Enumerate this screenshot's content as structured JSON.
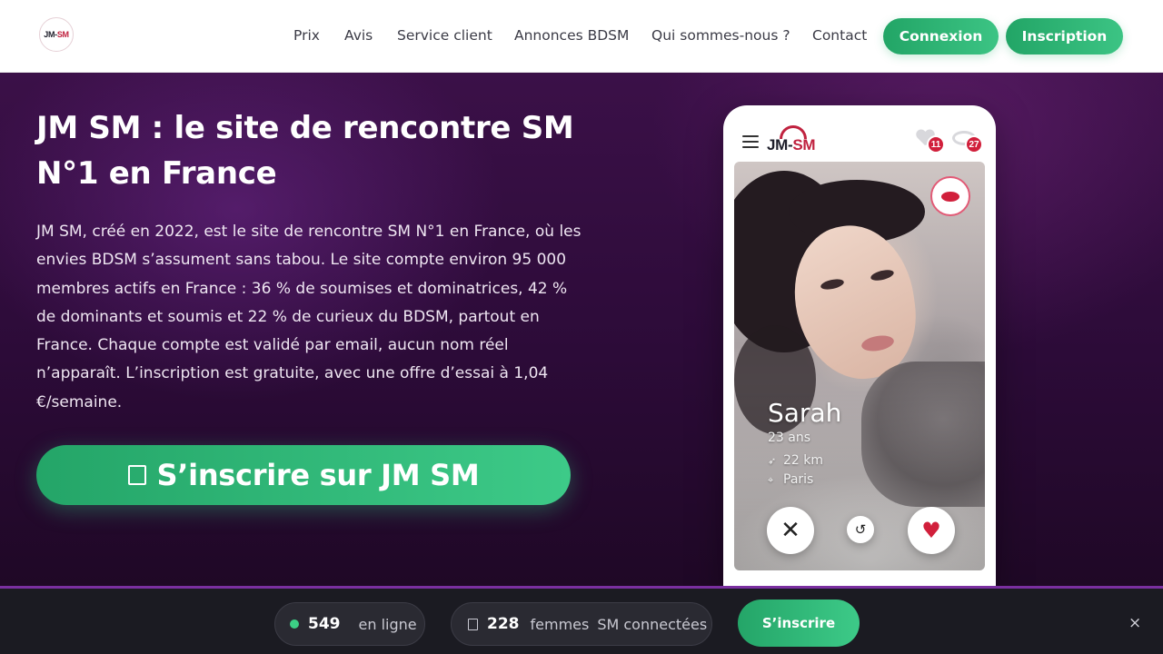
{
  "header": {
    "logo": {
      "text_a": "JM-",
      "text_b": "SM"
    },
    "nav": [
      "Prix",
      "Avis",
      "Service client",
      "Annonces BDSM",
      "Qui sommes-nous ?",
      "Contact"
    ],
    "login_label": "Connexion",
    "signup_label": "Inscription"
  },
  "hero": {
    "title_line1": "JM SM : le site de rencontre SM",
    "title_line2": "N°1 en France",
    "description": "JM SM, créé en 2022, est le site de rencontre SM N°1 en France, où les envies BDSM s’assument sans tabou. Le site compte environ 95 000 membres actifs en France : 36 % de soumises et dominatrices, 42 % de dominants et soumis et 22 % de curieux du BDSM, partout en France. Chaque compte est validé par email, aucun nom réel n’apparaît. L’inscription est gratuite, avec une offre d’essai à 1,04 €/semaine.",
    "cta_label": "S’inscrire sur JM SM"
  },
  "phone": {
    "logo": {
      "text_a": "JM-",
      "text_b": "SM"
    },
    "likes_count": "11",
    "views_count": "27",
    "profile": {
      "name": "Sarah",
      "age": "23 ans",
      "distance": "22 km",
      "city": "Paris"
    }
  },
  "bottom_bar": {
    "online_count": "549",
    "online_label": "en ligne",
    "women_count": "228",
    "women_label": "femmes",
    "women_suffix": "SM connectées",
    "cta_label": "S’inscrire",
    "close_glyph": "×"
  },
  "icons": {
    "menu": "hamburger-icon",
    "likes": "heart-icon",
    "views": "eye-icon",
    "kiss": "lips-icon",
    "reject": "close-icon",
    "undo": "undo-icon",
    "like": "heart-icon",
    "online": "status-dot-icon"
  },
  "colors": {
    "accent_green": "#2bb673",
    "brand_red": "#c0223f",
    "hero_purple": "#3b1048",
    "bar_dark": "#1b1b22"
  }
}
